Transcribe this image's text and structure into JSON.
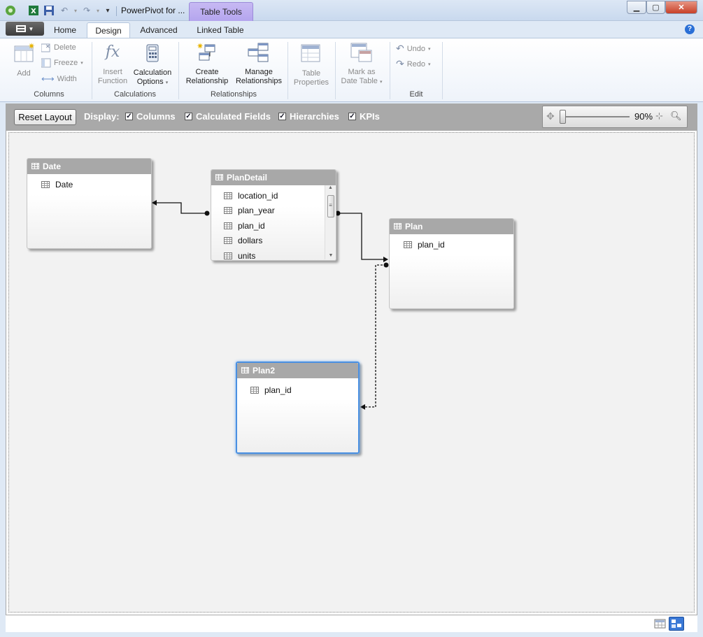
{
  "window": {
    "title": "PowerPivot for ...",
    "context_tab": "Table Tools"
  },
  "tabs": [
    {
      "label": "Home"
    },
    {
      "label": "Design"
    },
    {
      "label": "Advanced"
    },
    {
      "label": "Linked Table"
    }
  ],
  "ribbon": {
    "columns_group": {
      "label": "Columns",
      "add": "Add",
      "delete": "Delete",
      "freeze": "Freeze",
      "width": "Width"
    },
    "calculations_group": {
      "label": "Calculations",
      "insert_line1": "Insert",
      "insert_line2": "Function",
      "calc_line1": "Calculation",
      "calc_line2": "Options"
    },
    "relationships_group": {
      "label": "Relationships",
      "create_line1": "Create",
      "create_line2": "Relationship",
      "manage_line1": "Manage",
      "manage_line2": "Relationships"
    },
    "table_props": {
      "line1": "Table",
      "line2": "Properties"
    },
    "mark_date": {
      "line1": "Mark as",
      "line2": "Date Table"
    },
    "edit_group": {
      "label": "Edit",
      "undo": "Undo",
      "redo": "Redo"
    }
  },
  "display_bar": {
    "reset_label": "Reset Layout",
    "display_label": "Display:",
    "options": [
      {
        "label": "Columns",
        "checked": true
      },
      {
        "label": "Calculated Fields",
        "checked": true
      },
      {
        "label": "Hierarchies",
        "checked": true
      },
      {
        "label": "KPIs",
        "checked": true
      }
    ],
    "zoom": "90%",
    "zoom_level": 0.9
  },
  "tables": {
    "date": {
      "name": "Date",
      "columns": [
        "Date"
      ]
    },
    "plandetail": {
      "name": "PlanDetail",
      "columns": [
        "location_id",
        "plan_year",
        "plan_id",
        "dollars",
        "units"
      ]
    },
    "plan": {
      "name": "Plan",
      "columns": [
        "plan_id"
      ]
    },
    "plan2": {
      "name": "Plan2",
      "columns": [
        "plan_id"
      ]
    }
  },
  "relationships": [
    {
      "from": "PlanDetail",
      "to": "Date",
      "active": true
    },
    {
      "from": "PlanDetail",
      "to": "Plan",
      "active": true
    },
    {
      "from": "Plan",
      "to": "Plan2",
      "active": false
    }
  ],
  "colors": {
    "accent": "#4a90e2",
    "context_tab": "#b4a5ee",
    "table_header": "#a8a8a8"
  }
}
